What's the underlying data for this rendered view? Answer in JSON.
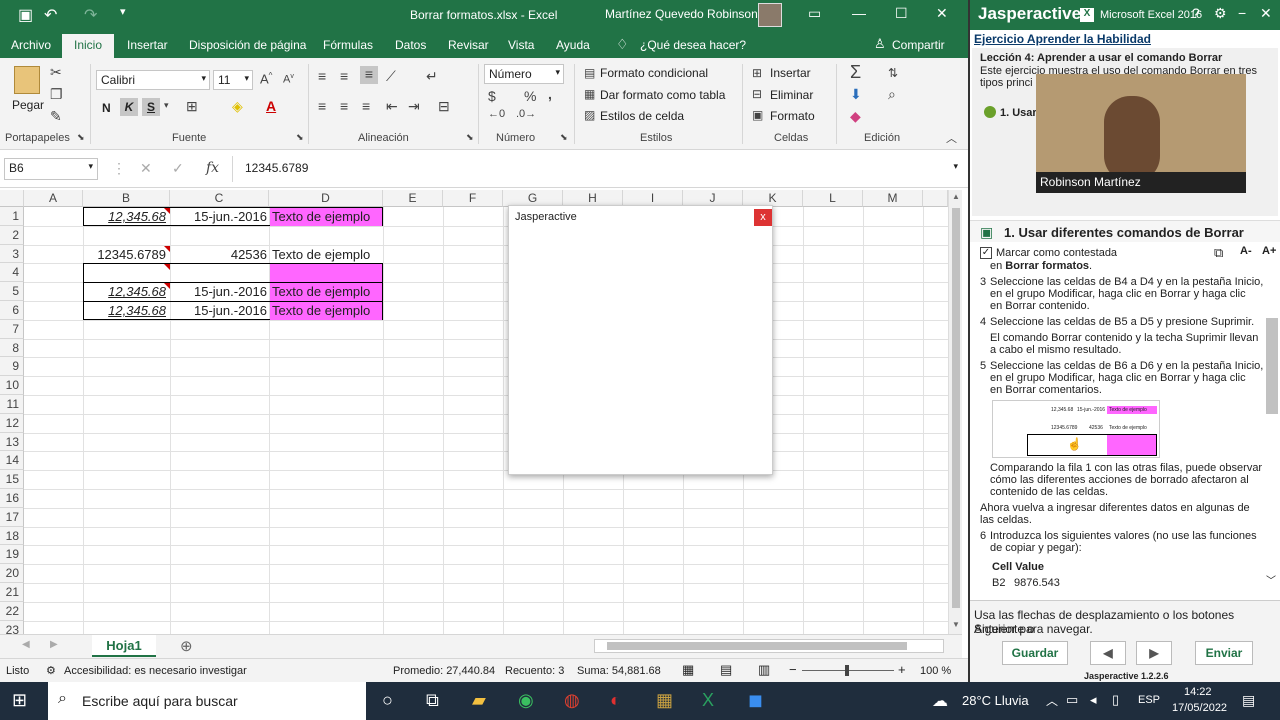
{
  "titlebar": {
    "doc_title": "Borrar formatos.xlsx  -  Excel",
    "user": "Martínez Quevedo  Robinson"
  },
  "tabs": [
    "Archivo",
    "Inicio",
    "Insertar",
    "Disposición de página",
    "Fórmulas",
    "Datos",
    "Revisar",
    "Vista",
    "Ayuda"
  ],
  "tell_me": "¿Qué desea hacer?",
  "share": "Compartir",
  "ribbon": {
    "paste": "Pegar",
    "font_name": "Calibri",
    "font_size": "11",
    "number_format": "Número",
    "cond_format": "Formato condicional",
    "table_format": "Dar formato como tabla",
    "cell_styles": "Estilos de celda",
    "insert": "Insertar",
    "delete": "Eliminar",
    "format": "Formato",
    "groups": {
      "clipboard": "Portapapeles",
      "font": "Fuente",
      "alignment": "Alineación",
      "number": "Número",
      "styles": "Estilos",
      "cells": "Celdas",
      "editing": "Edición"
    },
    "bold": "N",
    "italic": "K",
    "underline": "S"
  },
  "formula_bar": {
    "name_box": "B6",
    "fx": "fx",
    "value": "12345.6789"
  },
  "columns": [
    "A",
    "B",
    "C",
    "D",
    "E",
    "F",
    "G",
    "H",
    "I",
    "J",
    "K",
    "L",
    "M"
  ],
  "rows": [
    "1",
    "2",
    "3",
    "4",
    "5",
    "6",
    "7",
    "8",
    "9",
    "10",
    "11",
    "12",
    "13",
    "14",
    "15",
    "16",
    "17",
    "18",
    "19",
    "20",
    "21",
    "22",
    "23"
  ],
  "cells": {
    "b1": "12,345.68",
    "c1": "15-jun.-2016",
    "d1": "Texto de ejemplo",
    "b3": "12345.6789",
    "c3": "42536",
    "d3": "Texto de ejemplo",
    "b5": "12,345.68",
    "c5": "15-jun.-2016",
    "d5": "Texto de ejemplo",
    "b6": "12,345.68",
    "c6": "15-jun.-2016",
    "d6": "Texto de ejemplo"
  },
  "sheet_tab": "Hoja1",
  "status": {
    "ready": "Listo",
    "accessibility": "Accesibilidad: es necesario investigar",
    "average": "Promedio: 27,440.84",
    "count": "Recuento: 3",
    "sum": "Suma: 54,881.68",
    "zoom": "100 %"
  },
  "dialog": {
    "title": "Jasperactive",
    "close": "x"
  },
  "panel": {
    "brand": "Jasperactive",
    "excel_label": "Microsoft Excel 2016",
    "exercise_title": "Ejercicio Aprender la Habilidad",
    "lesson": "Lección 4: Aprender a usar el comando Borrar",
    "lesson_desc_1": "Este ejercicio muestra el uso del comando Borrar en tres",
    "lesson_desc_2": "tipos princi",
    "step_short": "1. Usar",
    "webcam_name": "Robinson Martínez",
    "section_title": "1. Usar diferentes comandos de Borrar",
    "mark_answered": "Marcar como contestada",
    "font_minus": "A-",
    "font_plus": "A+",
    "line_borrar_formatos_prefix": "en ",
    "line_borrar_formatos_bold": "Borrar formatos",
    "step3_num": "3",
    "step3_l1": "Seleccione las celdas de B4 a D4 y en la pestaña Inicio,",
    "step3_l2": "en el grupo Modificar, haga clic en Borrar y haga clic",
    "step3_l3": "en Borrar contenido.",
    "step4_num": "4",
    "step4_l1": "Seleccione las celdas de B5 a D5 y presione Suprimir.",
    "step4_note1": "El comando Borrar contenido y la techa Suprimir llevan",
    "step4_note2": "a cabo el mismo resultado.",
    "step5_num": "5",
    "step5_l1": "Seleccione las celdas de B6 a D6 y en la pestaña Inicio,",
    "step5_l2": "en el grupo Modificar, haga clic en Borrar y haga clic",
    "step5_l3": "en Borrar comentarios.",
    "compare_l1": "Comparando la fila 1 con las otras filas, puede observar",
    "compare_l2": "cómo las diferentes acciones de borrado afectaron al",
    "compare_l3": "contenido de las celdas.",
    "again_l1": "Ahora vuelva a ingresar diferentes datos en algunas de",
    "again_l2": "las celdas.",
    "step6_num": "6",
    "step6_l1": "Introduzca los siguientes valores (no use las funciones",
    "step6_l2": "de copiar y pegar):",
    "table_header": "Cell Value",
    "table_row1_cell": "B2",
    "table_row1_value": "9876.543",
    "nav_hint_l1": "Usa las flechas de desplazamiento o los botones Siguiente o",
    "nav_hint_l2": "Anterior para navegar.",
    "save": "Guardar",
    "send": "Enviar",
    "version": "Jasperactive 1.2.2.6",
    "thumb_b1": "12,345.68",
    "thumb_c1": "15-jun.-2016",
    "thumb_d1": "Texto de ejemplo",
    "thumb_b3": "12345.6789",
    "thumb_c3": "42536",
    "thumb_d3": "Texto de ejemplo"
  },
  "taskbar": {
    "search": "Escribe aquí para buscar",
    "weather": "28°C  Lluvia",
    "lang": "ESP",
    "time": "14:22",
    "date": "17/05/2022"
  },
  "colors": {
    "excel_green": "#217346",
    "highlight_pink": "#ff66ff",
    "taskbar": "#1f2d3d"
  }
}
